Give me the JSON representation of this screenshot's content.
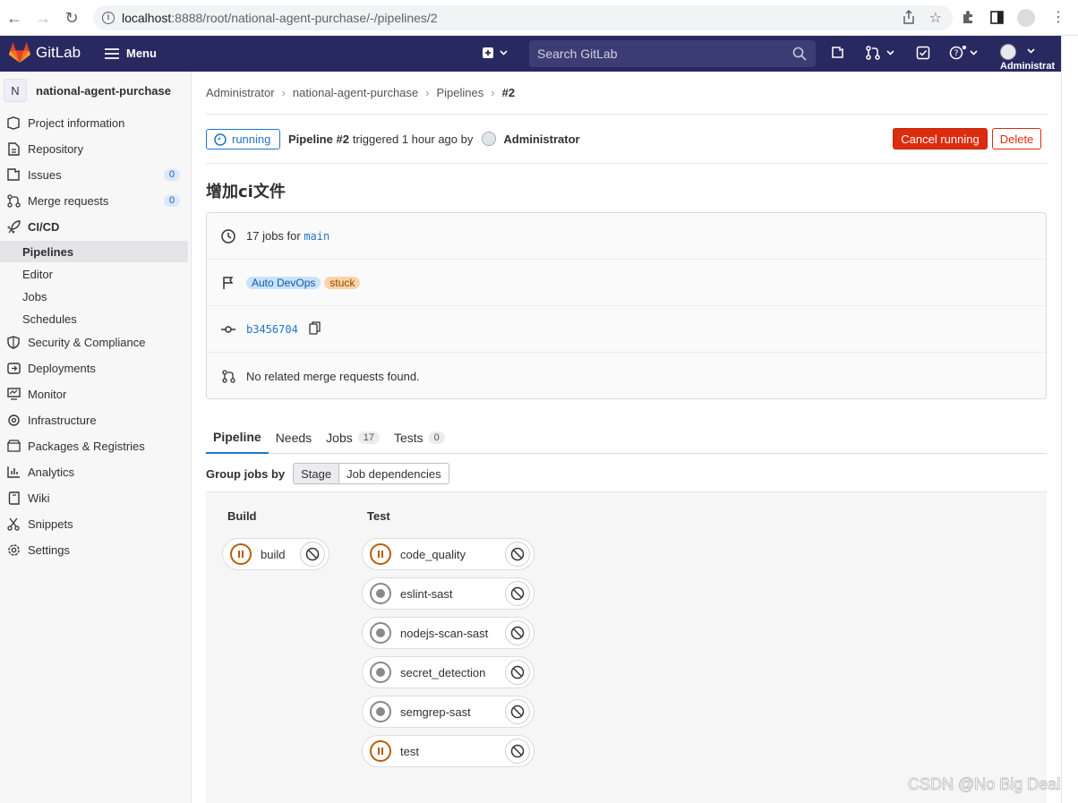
{
  "browser": {
    "url_host": "localhost",
    "url_rest": ":8888/root/national-agent-purchase/-/pipelines/2"
  },
  "topnav": {
    "logo_text": "GitLab",
    "menu_label": "Menu",
    "search_placeholder": "Search GitLab",
    "user_label": "Administrat"
  },
  "sidebar": {
    "project_initial": "N",
    "project_name": "national-agent-purchase",
    "items": [
      {
        "label": "Project information"
      },
      {
        "label": "Repository"
      },
      {
        "label": "Issues",
        "count": "0"
      },
      {
        "label": "Merge requests",
        "count": "0"
      },
      {
        "label": "CI/CD"
      },
      {
        "label": "Pipelines"
      },
      {
        "label": "Editor"
      },
      {
        "label": "Jobs"
      },
      {
        "label": "Schedules"
      },
      {
        "label": "Security & Compliance"
      },
      {
        "label": "Deployments"
      },
      {
        "label": "Monitor"
      },
      {
        "label": "Infrastructure"
      },
      {
        "label": "Packages & Registries"
      },
      {
        "label": "Analytics"
      },
      {
        "label": "Wiki"
      },
      {
        "label": "Snippets"
      },
      {
        "label": "Settings"
      }
    ]
  },
  "breadcrumbs": [
    "Administrator",
    "national-agent-purchase",
    "Pipelines",
    "#2"
  ],
  "pipeline": {
    "status": "running",
    "title": "Pipeline #2",
    "triggered_text": "triggered 1 hour ago by",
    "user": "Administrator",
    "cancel_label": "Cancel running",
    "delete_label": "Delete",
    "commit_title": "增加ci文件"
  },
  "info": {
    "jobs_text": "17 jobs for",
    "branch": "main",
    "tag_devops": "Auto DevOps",
    "tag_stuck": "stuck",
    "sha": "b3456704",
    "mr_text": "No related merge requests found."
  },
  "tabs": [
    {
      "label": "Pipeline"
    },
    {
      "label": "Needs"
    },
    {
      "label": "Jobs",
      "count": "17"
    },
    {
      "label": "Tests",
      "count": "0"
    }
  ],
  "groupby": {
    "label": "Group jobs by",
    "options": [
      "Stage",
      "Job dependencies"
    ]
  },
  "stages": [
    {
      "name": "Build",
      "jobs": [
        {
          "name": "build",
          "status": "paused"
        }
      ]
    },
    {
      "name": "Test",
      "jobs": [
        {
          "name": "code_quality",
          "status": "paused"
        },
        {
          "name": "eslint-sast",
          "status": "created"
        },
        {
          "name": "nodejs-scan-sast",
          "status": "created"
        },
        {
          "name": "secret_detection",
          "status": "created"
        },
        {
          "name": "semgrep-sast",
          "status": "created"
        },
        {
          "name": "test",
          "status": "paused"
        }
      ]
    }
  ],
  "watermark": "CSDN @No Big Deal",
  "colors": {
    "nav_bg": "#292961",
    "accent": "#1f75cb",
    "danger": "#dd2b0e",
    "paused": "#b65d0a"
  }
}
